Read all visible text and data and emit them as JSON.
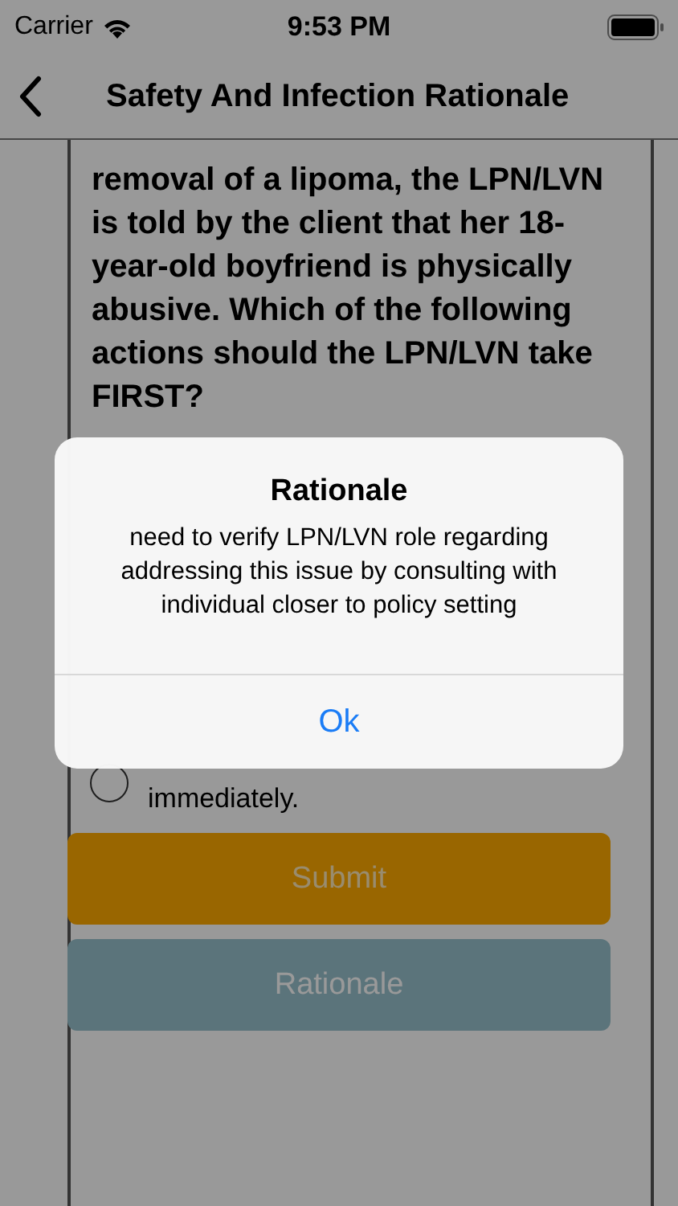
{
  "status_bar": {
    "carrier": "Carrier",
    "time": "9:53 PM"
  },
  "nav": {
    "title": "Safety And Infection Rationale"
  },
  "question": "removal of a lipoma, the LPN/LVN is told by the client that her 18-year-old boyfriend is physically abusive. Which of the following actions should the LPN/LVN take FIRST?",
  "options": [
    {
      "text": "immediately.",
      "selected": false
    }
  ],
  "buttons": [
    {
      "label": "Submit",
      "kind": "submit"
    },
    {
      "label": "Rationale",
      "kind": "rationale"
    }
  ],
  "alert": {
    "title": "Rationale",
    "message": "need to verify LPN/LVN role regarding addressing this issue by consulting with individual closer to policy setting",
    "button": "Ok"
  }
}
